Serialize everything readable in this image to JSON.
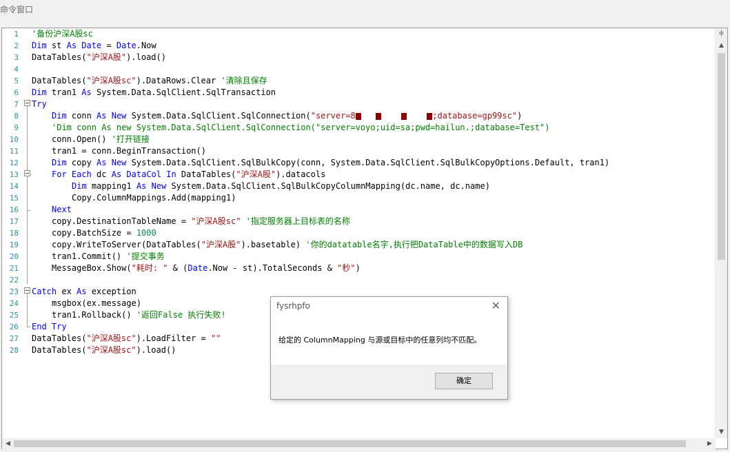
{
  "window": {
    "title": "命令窗口"
  },
  "editor": {
    "line_numbers": [
      "1",
      "2",
      "3",
      "4",
      "5",
      "6",
      "7",
      "8",
      "9",
      "10",
      "11",
      "12",
      "13",
      "14",
      "15",
      "16",
      "17",
      "18",
      "19",
      "20",
      "21",
      "22",
      "23",
      "24",
      "25",
      "26",
      "27",
      "28"
    ]
  },
  "code": {
    "l1": "'备份沪深A股sc",
    "l2a": "Dim",
    "l2b": " st ",
    "l2c": "As",
    "l2d": " ",
    "l2e": "Date",
    "l2f": " = ",
    "l2g": "Date",
    "l2h": ".Now",
    "l3a": "DataTables(",
    "l3b": "\"沪深A股\"",
    "l3c": ").load()",
    "l5a": "DataTables(",
    "l5b": "\"沪深A股sc\"",
    "l5c": ").DataRows.Clear ",
    "l5d": "'清除且保存",
    "l6a": "Dim",
    "l6b": " tran1 ",
    "l6c": "As",
    "l6d": " System.Data.SqlClient.SqlTransaction",
    "l7": "Try",
    "l8a": "Dim",
    "l8b": " conn ",
    "l8c": "As",
    "l8d": " ",
    "l8e": "New",
    "l8f": " System.Data.SqlClient.SqlConnection(",
    "l8g": "\"server=8",
    "l8h": ";database=gp99sc\"",
    "l8i": ")",
    "l9": "'Dim conn As new System.Data.SqlClient.SqlConnection(\"server=voyo;uid=sa;pwd=hailun.;database=Test\")",
    "l10a": "conn.Open() ",
    "l10b": "'打开链接",
    "l11": "tran1 = conn.BeginTransaction()",
    "l12a": "Dim",
    "l12b": " copy ",
    "l12c": "As",
    "l12d": " ",
    "l12e": "New",
    "l12f": " System.Data.SqlClient.SqlBulkCopy(conn, System.Data.SqlClient.SqlBulkCopyOptions.Default, tran1)",
    "l13a": "For",
    "l13b": " ",
    "l13c": "Each",
    "l13d": " dc ",
    "l13e": "As",
    "l13f": " ",
    "l13g": "DataCol",
    "l13h": " ",
    "l13i": "In",
    "l13j": " DataTables(",
    "l13k": "\"沪深A股\"",
    "l13l": ").datacols",
    "l14a": "Dim",
    "l14b": " mapping1 ",
    "l14c": "As",
    "l14d": " ",
    "l14e": "New",
    "l14f": " System.Data.SqlClient.SqlBulkCopyColumnMapping(dc.name, dc.name)",
    "l15": "Copy.ColumnMappings.Add(mapping1)",
    "l16": "Next",
    "l17a": "copy.DestinationTableName = ",
    "l17b": "\"沪深A股sc\"",
    "l17c": " ",
    "l17d": "'指定服务器上目标表的名称",
    "l18a": "copy.BatchSize = ",
    "l18b": "1000",
    "l19a": "copy.WriteToServer(DataTables(",
    "l19b": "\"沪深A股\"",
    "l19c": ").basetable) ",
    "l19d": "'你的datatable名字,执行把DataTable中的数据写入DB",
    "l20a": "tran1.Commit() ",
    "l20b": "'提交事务",
    "l21a": "MessageBox.Show(",
    "l21b": "\"耗时: \"",
    "l21c": " & (",
    "l21d": "Date",
    "l21e": ".Now - st).TotalSeconds & ",
    "l21f": "\"秒\"",
    "l21g": ")",
    "l23a": "Catch",
    "l23b": " ex ",
    "l23c": "As",
    "l23d": " exception",
    "l24": "msgbox(ex.message)",
    "l25a": "tran1.Rollback() ",
    "l25b": "'返回False 执行失败!",
    "l26a": "End",
    "l26b": " ",
    "l26c": "Try",
    "l27a": "DataTables(",
    "l27b": "\"沪深A股sc\"",
    "l27c": ").LoadFilter = ",
    "l27d": "\"\"",
    "l28a": "DataTables(",
    "l28b": "\"沪深A股sc\"",
    "l28c": ").load()"
  },
  "scrollbar": {
    "top_icon": "split-icon",
    "top_glyph": "⫩",
    "up_glyph": "▲",
    "down_glyph": "▼",
    "left_glyph": "◀",
    "right_glyph": "▶"
  },
  "dialog": {
    "title": "fysrhpfo",
    "close_glyph": "✕",
    "message": "给定的 ColumnMapping 与源或目标中的任意列均不匹配。",
    "ok_label": "确定"
  },
  "colors": {
    "keyword": "#0000ff",
    "string": "#a31515",
    "comment": "#008000",
    "number": "#098658",
    "line_number": "#2b91af"
  }
}
